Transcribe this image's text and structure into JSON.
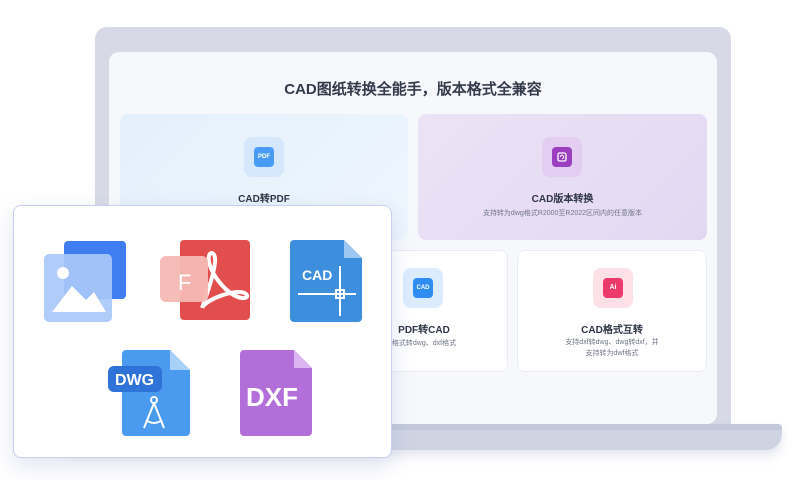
{
  "screen": {
    "title": "CAD图纸转换全能手，版本格式全兼容"
  },
  "cards": {
    "cad_to_pdf": {
      "title": "CAD转PDF",
      "icon_label": "PDF",
      "icon": "pdf-icon",
      "color": "#4a9bf5"
    },
    "cad_version": {
      "title": "CAD版本转换",
      "desc": "支持转为dwg格式R2000至R2022区间内的任意版本",
      "icon": "refresh-icon",
      "color": "#9b3fc0"
    },
    "pdf_to_cad": {
      "title": "PDF转CAD",
      "desc": "格式转dwg、dxf格式",
      "icon_label": "CAD",
      "icon": "cad-icon",
      "color": "#2f8cf0"
    },
    "cad_format": {
      "title": "CAD格式互转",
      "desc_line1": "支持dxf转dwg、dwg转dxf，并",
      "desc_line2": "支持转为dwf格式",
      "icon_label": "Ai",
      "icon": "ai-icon",
      "color": "#ec3a6a"
    }
  },
  "file_icons": {
    "image": {
      "icon": "image-file-icon"
    },
    "pdf": {
      "icon": "pdf-file-icon",
      "label": "F"
    },
    "cad": {
      "icon": "cad-file-icon",
      "label": "CAD"
    },
    "dwg": {
      "icon": "dwg-file-icon",
      "label": "DWG"
    },
    "dxf": {
      "icon": "dxf-file-icon",
      "label": "DXF"
    }
  },
  "colors": {
    "accent_blue": "#4a9bf5",
    "accent_purple": "#9b3fc0",
    "accent_pink": "#ec3a6a",
    "pdf_red": "#e24d4d",
    "dxf_purple": "#b36fd9"
  }
}
